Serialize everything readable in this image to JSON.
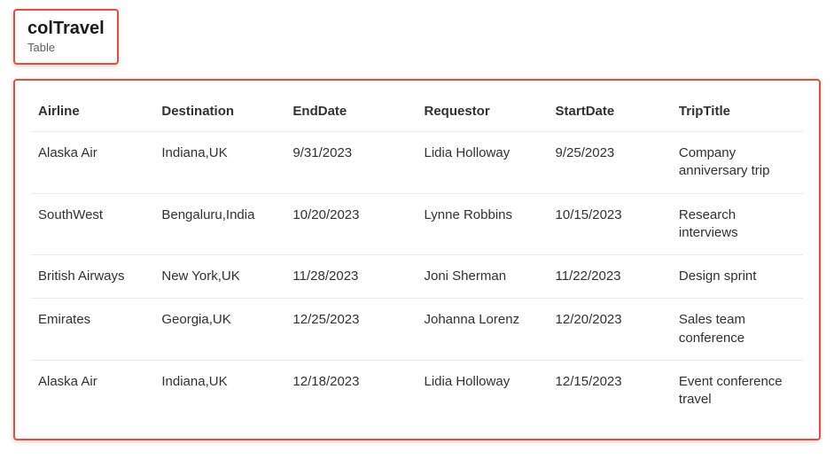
{
  "header": {
    "title": "colTravel",
    "subtitle": "Table"
  },
  "table": {
    "columns": [
      "Airline",
      "Destination",
      "EndDate",
      "Requestor",
      "StartDate",
      "TripTitle"
    ],
    "rows": [
      {
        "Airline": "Alaska Air",
        "Destination": "Indiana,UK",
        "EndDate": "9/31/2023",
        "Requestor": "Lidia Holloway",
        "StartDate": "9/25/2023",
        "TripTitle": "Company anniversary trip"
      },
      {
        "Airline": "SouthWest",
        "Destination": "Bengaluru,India",
        "EndDate": "10/20/2023",
        "Requestor": "Lynne Robbins",
        "StartDate": "10/15/2023",
        "TripTitle": "Research interviews"
      },
      {
        "Airline": "British Airways",
        "Destination": "New York,UK",
        "EndDate": "11/28/2023",
        "Requestor": "Joni Sherman",
        "StartDate": "11/22/2023",
        "TripTitle": "Design sprint"
      },
      {
        "Airline": "Emirates",
        "Destination": "Georgia,UK",
        "EndDate": "12/25/2023",
        "Requestor": "Johanna Lorenz",
        "StartDate": "12/20/2023",
        "TripTitle": "Sales team conference"
      },
      {
        "Airline": "Alaska Air",
        "Destination": "Indiana,UK",
        "EndDate": "12/18/2023",
        "Requestor": "Lidia Holloway",
        "StartDate": "12/15/2023",
        "TripTitle": "Event conference travel"
      }
    ]
  }
}
